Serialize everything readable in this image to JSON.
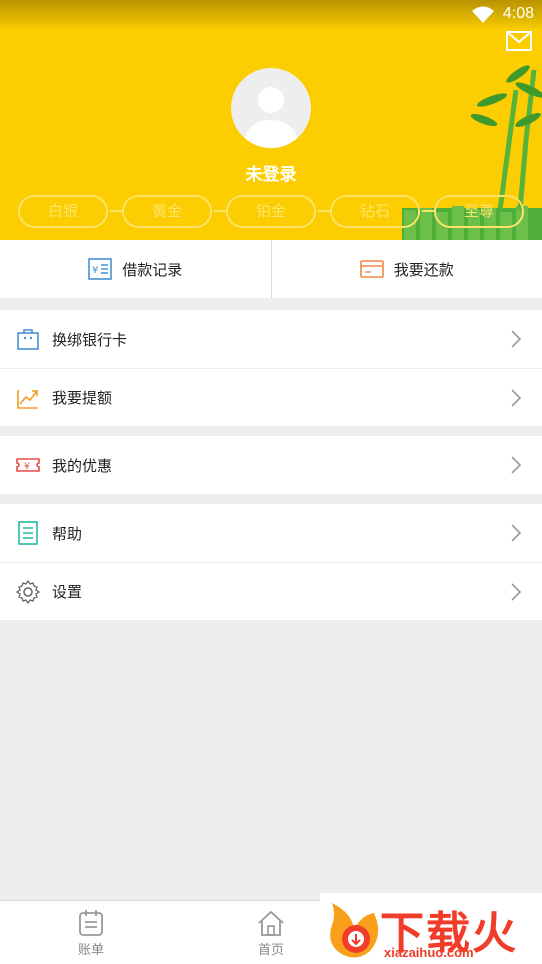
{
  "status_bar": {
    "time": "4:08"
  },
  "header": {
    "login_status": "未登录",
    "levels": [
      "白银",
      "黄金",
      "铂金",
      "钻石",
      "至尊"
    ]
  },
  "quick_actions": [
    {
      "label": "借款记录",
      "icon": "loan-record-icon"
    },
    {
      "label": "我要还款",
      "icon": "repay-card-icon"
    }
  ],
  "menu_groups": [
    [
      {
        "label": "换绑银行卡",
        "icon": "bank-card-bag-icon"
      },
      {
        "label": "我要提额",
        "icon": "trend-up-icon"
      }
    ],
    [
      {
        "label": "我的优惠",
        "icon": "coupon-icon"
      }
    ],
    [
      {
        "label": "帮助",
        "icon": "help-doc-icon"
      },
      {
        "label": "设置",
        "icon": "gear-icon"
      }
    ]
  ],
  "tabbar": {
    "tabs": [
      {
        "label": "账单",
        "icon": "bill-calendar-icon"
      },
      {
        "label": "首页",
        "icon": "home-icon"
      }
    ]
  },
  "watermark": {
    "title": "下载火",
    "subtitle": "xiazaihuo.com"
  },
  "colors": {
    "header_yellow": "#fccd00",
    "level_outline": "#fde468",
    "watermark_red": "#f03c28"
  }
}
